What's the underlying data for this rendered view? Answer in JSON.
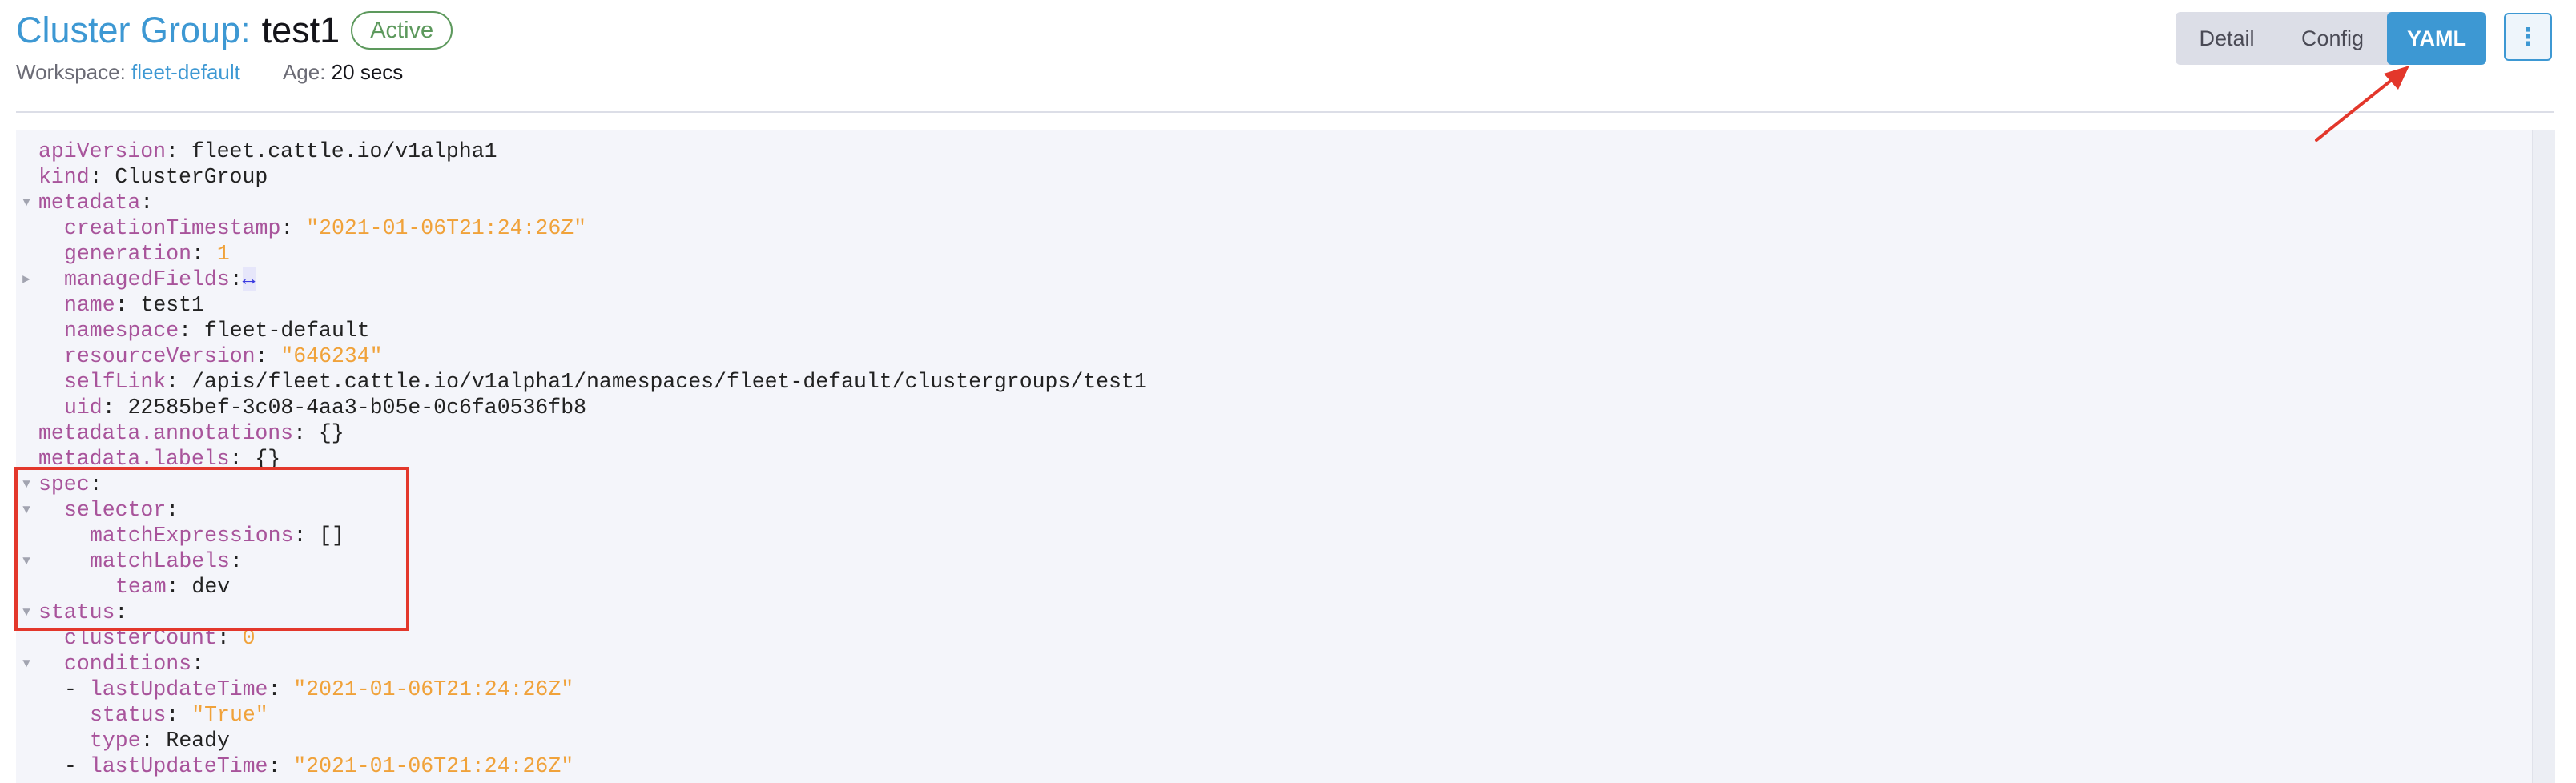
{
  "header": {
    "title_prefix": "Cluster Group:",
    "title_name": "test1",
    "state": "Active",
    "workspace_label": "Workspace:",
    "workspace_value": "fleet-default",
    "age_label": "Age:",
    "age_value": "20 secs"
  },
  "mode_buttons": {
    "detail": "Detail",
    "config": "Config",
    "yaml": "YAML",
    "active": "YAML"
  },
  "actions_icon": "⋮",
  "colors": {
    "accent": "#3d98d3",
    "active_badge": "#5d995d",
    "yaml_key": "#a8549b",
    "yaml_string": "#f0a23a",
    "annotation": "#e3372b"
  },
  "yaml_lines": [
    {
      "fold": "",
      "indent": 0,
      "parts": [
        {
          "t": "key",
          "v": "apiVersion"
        },
        {
          "t": "plain",
          "v": ": fleet.cattle.io/v1alpha1"
        }
      ]
    },
    {
      "fold": "",
      "indent": 0,
      "parts": [
        {
          "t": "key",
          "v": "kind"
        },
        {
          "t": "plain",
          "v": ": ClusterGroup"
        }
      ]
    },
    {
      "fold": "open",
      "indent": 0,
      "parts": [
        {
          "t": "key",
          "v": "metadata"
        },
        {
          "t": "plain",
          "v": ":"
        }
      ]
    },
    {
      "fold": "",
      "indent": 1,
      "parts": [
        {
          "t": "key",
          "v": "creationTimestamp"
        },
        {
          "t": "plain",
          "v": ": "
        },
        {
          "t": "str",
          "v": "\"2021-01-06T21:24:26Z\""
        }
      ]
    },
    {
      "fold": "",
      "indent": 1,
      "parts": [
        {
          "t": "key",
          "v": "generation"
        },
        {
          "t": "plain",
          "v": ": "
        },
        {
          "t": "num",
          "v": "1"
        }
      ]
    },
    {
      "fold": "closed",
      "indent": 1,
      "parts": [
        {
          "t": "key",
          "v": "managedFields"
        },
        {
          "t": "plain",
          "v": ":"
        },
        {
          "t": "widget",
          "v": "↔"
        }
      ]
    },
    {
      "fold": "",
      "indent": 1,
      "parts": [
        {
          "t": "key",
          "v": "name"
        },
        {
          "t": "plain",
          "v": ": test1"
        }
      ]
    },
    {
      "fold": "",
      "indent": 1,
      "parts": [
        {
          "t": "key",
          "v": "namespace"
        },
        {
          "t": "plain",
          "v": ": fleet-default"
        }
      ]
    },
    {
      "fold": "",
      "indent": 1,
      "parts": [
        {
          "t": "key",
          "v": "resourceVersion"
        },
        {
          "t": "plain",
          "v": ": "
        },
        {
          "t": "str",
          "v": "\"646234\""
        }
      ]
    },
    {
      "fold": "",
      "indent": 1,
      "parts": [
        {
          "t": "key",
          "v": "selfLink"
        },
        {
          "t": "plain",
          "v": ": /apis/fleet.cattle.io/v1alpha1/namespaces/fleet-default/clustergroups/test1"
        }
      ]
    },
    {
      "fold": "",
      "indent": 1,
      "parts": [
        {
          "t": "key",
          "v": "uid"
        },
        {
          "t": "plain",
          "v": ": 22585bef-3c08-4aa3-b05e-0c6fa0536fb8"
        }
      ]
    },
    {
      "fold": "",
      "indent": 0,
      "parts": [
        {
          "t": "key",
          "v": "metadata.annotations"
        },
        {
          "t": "plain",
          "v": ": {}"
        }
      ]
    },
    {
      "fold": "",
      "indent": 0,
      "parts": [
        {
          "t": "key",
          "v": "metadata.labels"
        },
        {
          "t": "plain",
          "v": ": {}"
        }
      ]
    },
    {
      "fold": "open",
      "indent": 0,
      "parts": [
        {
          "t": "key",
          "v": "spec"
        },
        {
          "t": "plain",
          "v": ":"
        }
      ]
    },
    {
      "fold": "open",
      "indent": 1,
      "parts": [
        {
          "t": "key",
          "v": "selector"
        },
        {
          "t": "plain",
          "v": ":"
        }
      ]
    },
    {
      "fold": "",
      "indent": 2,
      "parts": [
        {
          "t": "key",
          "v": "matchExpressions"
        },
        {
          "t": "plain",
          "v": ": []"
        }
      ]
    },
    {
      "fold": "open",
      "indent": 2,
      "parts": [
        {
          "t": "key",
          "v": "matchLabels"
        },
        {
          "t": "plain",
          "v": ":"
        }
      ]
    },
    {
      "fold": "",
      "indent": 3,
      "parts": [
        {
          "t": "key",
          "v": "team"
        },
        {
          "t": "plain",
          "v": ": dev"
        }
      ]
    },
    {
      "fold": "open",
      "indent": 0,
      "parts": [
        {
          "t": "key",
          "v": "status"
        },
        {
          "t": "plain",
          "v": ":"
        }
      ]
    },
    {
      "fold": "",
      "indent": 1,
      "parts": [
        {
          "t": "key",
          "v": "clusterCount"
        },
        {
          "t": "plain",
          "v": ": "
        },
        {
          "t": "num",
          "v": "0"
        }
      ]
    },
    {
      "fold": "open",
      "indent": 1,
      "parts": [
        {
          "t": "key",
          "v": "conditions"
        },
        {
          "t": "plain",
          "v": ":"
        }
      ]
    },
    {
      "fold": "",
      "indent": 1,
      "parts": [
        {
          "t": "plain",
          "v": "- "
        },
        {
          "t": "key",
          "v": "lastUpdateTime"
        },
        {
          "t": "plain",
          "v": ": "
        },
        {
          "t": "str",
          "v": "\"2021-01-06T21:24:26Z\""
        }
      ]
    },
    {
      "fold": "",
      "indent": 2,
      "parts": [
        {
          "t": "key",
          "v": "status"
        },
        {
          "t": "plain",
          "v": ": "
        },
        {
          "t": "str",
          "v": "\"True\""
        }
      ]
    },
    {
      "fold": "",
      "indent": 2,
      "parts": [
        {
          "t": "key",
          "v": "type"
        },
        {
          "t": "plain",
          "v": ": Ready"
        }
      ]
    },
    {
      "fold": "",
      "indent": 1,
      "parts": [
        {
          "t": "plain",
          "v": "- "
        },
        {
          "t": "key",
          "v": "lastUpdateTime"
        },
        {
          "t": "plain",
          "v": ": "
        },
        {
          "t": "str",
          "v": "\"2021-01-06T21:24:26Z\""
        }
      ]
    }
  ]
}
